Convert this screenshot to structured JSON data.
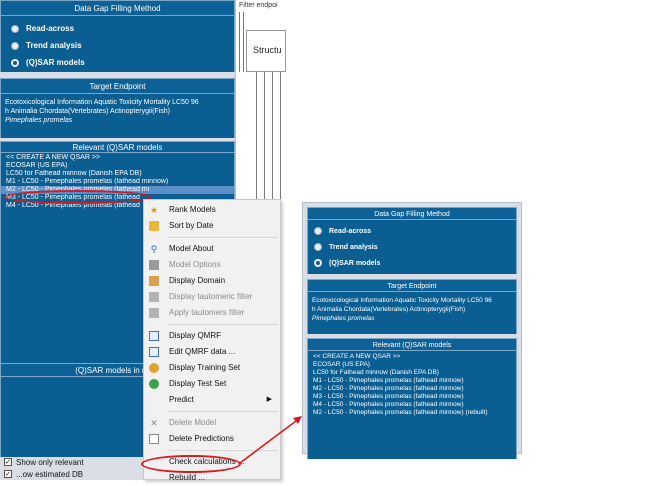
{
  "left": {
    "data_gap_title": "Data Gap Filling Method",
    "methods": [
      {
        "label": "Read-across",
        "selected": false
      },
      {
        "label": "Trend analysis",
        "selected": false
      },
      {
        "label": "(Q)SAR models",
        "selected": true
      }
    ],
    "target_title": "Target Endpoint",
    "endpoint_line1": "Ecotoxicological Information Aquatic Toxicity Mortality LC50 96",
    "endpoint_line2": "h Animalia Chordata(Vertebrates) Actinopterygii(Fish)",
    "endpoint_line3": "Pimephales promelas",
    "relevant_title": "Relevant (Q)SAR models",
    "models": [
      "<< CREATE A NEW QSAR >>",
      "ECOSAR (US EPA)",
      "LC50 for Fathead minnow (Danish EPA DB)",
      "M1 - LC50 - Pimephales promelas (fathead minnow)",
      "M2 - LC50 - Pimephales promelas (fathead mi",
      "M3 - LC50 - Pimephales promelas (fathead",
      "M4 - LC50 - Pimephales promelas (fathead"
    ],
    "in_node_title": "(Q)SAR models in node",
    "show_only_relevant": "Show only relevant",
    "hidden_check": "...ow estimated DB"
  },
  "filter": {
    "label": "Filter endpoi",
    "struct": "Structu"
  },
  "menu": {
    "items": [
      {
        "label": "Rank Models",
        "icon": "rank-icon",
        "disabled": false
      },
      {
        "label": "Sort by Date",
        "icon": "folder-icon",
        "disabled": false
      },
      {
        "label": "Model About",
        "icon": "magnifier-icon",
        "disabled": false
      },
      {
        "label": "Model Options",
        "icon": "options-icon",
        "disabled": true
      },
      {
        "label": "Display Domain",
        "icon": "domain-icon",
        "disabled": false
      },
      {
        "label": "Display tautomeric filter",
        "icon": "filter-icon",
        "disabled": true
      },
      {
        "label": "Apply tautomers filter",
        "icon": "filter-icon",
        "disabled": true
      },
      {
        "label": "Display QMRF",
        "icon": "qmrf-icon",
        "disabled": false
      },
      {
        "label": "Edit QMRF data ...",
        "icon": "edit-icon",
        "disabled": false
      },
      {
        "label": "Display Training Set",
        "icon": "training-set-icon",
        "disabled": false
      },
      {
        "label": "Display Test Set",
        "icon": "test-set-icon",
        "disabled": false
      },
      {
        "label": "Predict",
        "icon": "",
        "disabled": false,
        "submenu": true
      },
      {
        "label": "Delete Model",
        "icon": "delete-icon",
        "disabled": true
      },
      {
        "label": "Delete Predictions",
        "icon": "document-icon",
        "disabled": false
      },
      {
        "label": "Check calculations ...",
        "icon": "",
        "disabled": false
      },
      {
        "label": "Rebuild ...",
        "icon": "",
        "disabled": false
      }
    ]
  },
  "right": {
    "data_gap_title": "Data Gap Filling Method",
    "methods": [
      {
        "label": "Read-across",
        "selected": false
      },
      {
        "label": "Trend analysis",
        "selected": false
      },
      {
        "label": "(Q)SAR models",
        "selected": true
      }
    ],
    "target_title": "Target Endpoint",
    "endpoint_line1": "Ecotoxicological Information Aquatic Toxicity Mortality LC50 96",
    "endpoint_line2": "h Animalia Chordata(Vertebrates) Actinopterygii(Fish)",
    "endpoint_line3": "Pimephales promelas",
    "relevant_title": "Relevant (Q)SAR models",
    "models": [
      "<< CREATE A NEW QSAR >>",
      "ECOSAR (US EPA)",
      "LC50 for Fathead minnow (Danish EPA DB)",
      "M1 - LC50 - Pimephales promelas (fathead minnow)",
      "M2 - LC50 - Pimephales promelas (fathead minnow)",
      "M3 - LC50 - Pimephales promelas (fathead minnow)",
      "M4 - LC50 - Pimephales promelas (fathead minnow)",
      "M2 - LC50 - Pimephales promelas (fathead minnow) (rebuilt)"
    ]
  },
  "colors": {
    "panel_blue": "#0b5e92",
    "header_blue": "#0d6196",
    "selection": "#5c8fc7",
    "annotation_red": "#d71920"
  }
}
